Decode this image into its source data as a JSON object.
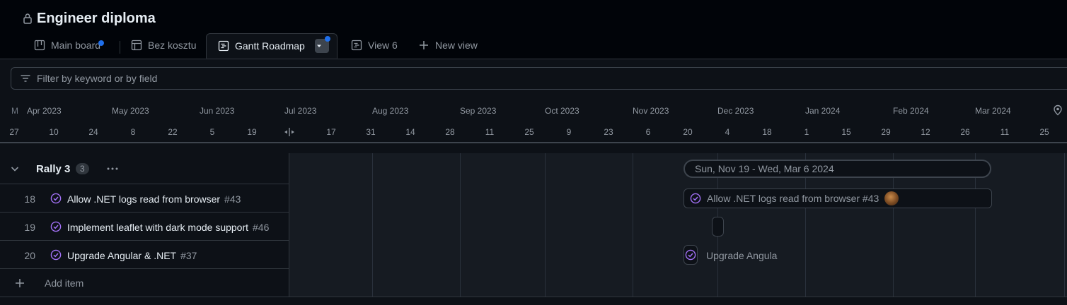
{
  "project": {
    "title": "Engineer diploma"
  },
  "tabs": [
    {
      "label": "Main board"
    },
    {
      "label": "Bez kosztu"
    },
    {
      "label": "Gantt Roadmap"
    },
    {
      "label": "View 6"
    },
    {
      "label": "New view"
    }
  ],
  "filter": {
    "placeholder": "Filter by keyword or by field"
  },
  "timeline": {
    "months_partial": "M",
    "months": [
      "Apr 2023",
      "May 2023",
      "Jun 2023",
      "Jul 2023",
      "Aug 2023",
      "Sep 2023",
      "Oct 2023",
      "Nov 2023",
      "Dec 2023",
      "Jan 2024",
      "Feb 2024",
      "Mar 2024"
    ],
    "days": [
      "27",
      "10",
      "24",
      "8",
      "22",
      "5",
      "19",
      "17",
      "31",
      "14",
      "28",
      "11",
      "25",
      "9",
      "23",
      "6",
      "20",
      "4",
      "18",
      "1",
      "15",
      "29",
      "12",
      "26",
      "11",
      "25"
    ]
  },
  "group": {
    "name": "Rally 3",
    "count": "3"
  },
  "items": [
    {
      "row": "18",
      "title": "Allow .NET logs read from browser",
      "number": "#43"
    },
    {
      "row": "19",
      "title": "Implement leaflet with dark mode support",
      "number": "#46"
    },
    {
      "row": "20",
      "title": "Upgrade Angular & .NET",
      "number": "#37"
    }
  ],
  "add_item": {
    "label": "Add item"
  },
  "gantt": {
    "date_range": "Sun, Nov 19 - Wed, Mar 6 2024",
    "bar_label": "Allow .NET logs read from browser #43",
    "bar3_label": "Upgrade Angula"
  },
  "colors": {
    "accent_purple": "#a371f7",
    "blue_dot": "#1f6feb"
  }
}
